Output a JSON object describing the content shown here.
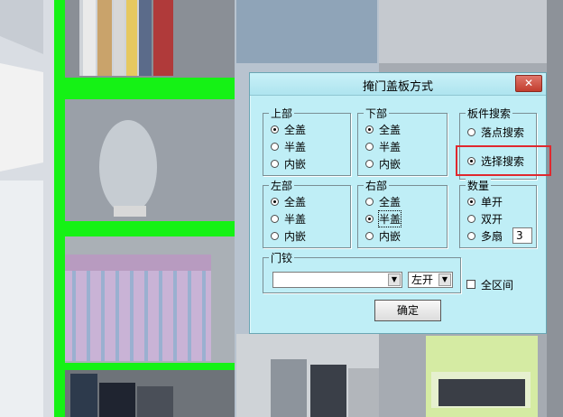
{
  "dialog": {
    "title": "掩门盖板方式",
    "close_symbol": "✕",
    "top_group": {
      "label": "上部",
      "options": [
        "全盖",
        "半盖",
        "内嵌"
      ],
      "selected_index": 0
    },
    "bottom_group": {
      "label": "下部",
      "options": [
        "全盖",
        "半盖",
        "内嵌"
      ],
      "selected_index": 0
    },
    "search_group": {
      "label": "板件搜索",
      "options": [
        "落点搜索",
        "选择搜索"
      ],
      "selected_index": 1
    },
    "left_group": {
      "label": "左部",
      "options": [
        "全盖",
        "半盖",
        "内嵌"
      ],
      "selected_index": 0
    },
    "right_group": {
      "label": "右部",
      "options": [
        "全盖",
        "半盖",
        "内嵌"
      ],
      "selected_index": 1
    },
    "count_group": {
      "label": "数量",
      "options": [
        "单开",
        "双开",
        "多扇"
      ],
      "selected_index": 0,
      "multi_count": "3"
    },
    "lock_group": {
      "label": "门铰",
      "lock_value": "",
      "direction_value": "左开"
    },
    "full_range_label": "全区间",
    "ok_label": "确定"
  },
  "colors": {
    "dialog_bg": "#bfeef6",
    "highlight": "#e0282e",
    "scene_green": "#15f215"
  }
}
